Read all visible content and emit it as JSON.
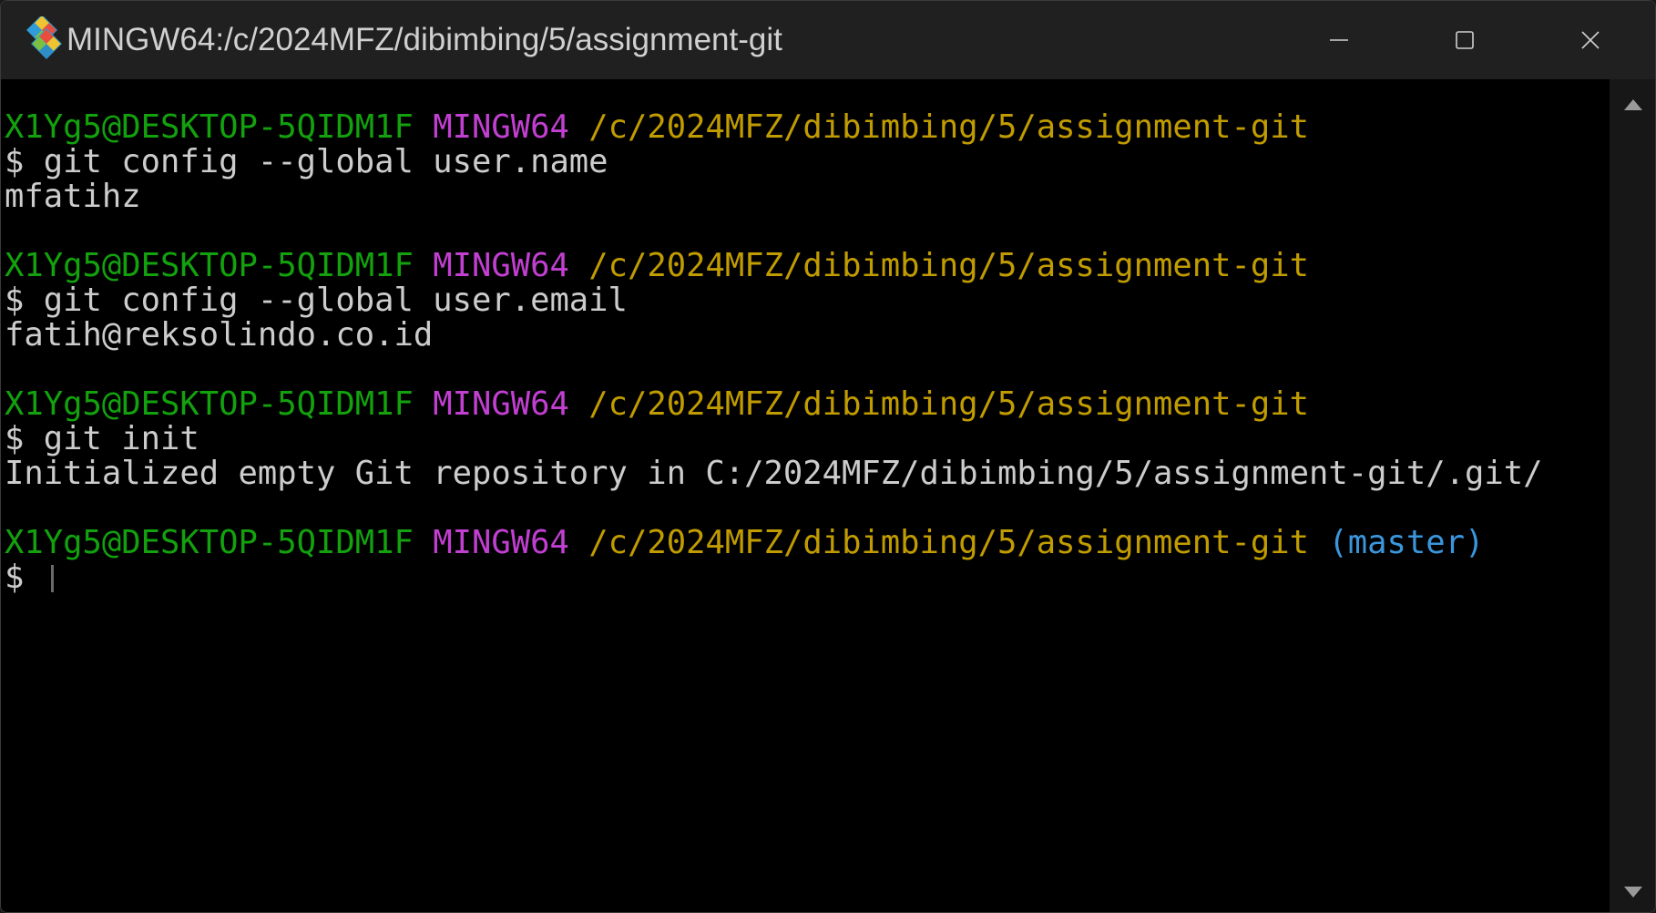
{
  "window": {
    "title": "MINGW64:/c/2024MFZ/dibimbing/5/assignment-git",
    "icon": "git-bash-icon",
    "controls": {
      "minimize": "minimize-icon",
      "maximize": "maximize-icon",
      "close": "close-icon"
    }
  },
  "colors": {
    "user_host": "#13a10e",
    "system": "#c13fd1",
    "path": "#c19c00",
    "branch": "#3a96dd",
    "text": "#cccccc",
    "background": "#000000"
  },
  "terminal": {
    "blocks": [
      {
        "prompt": {
          "user": "X1Yg5@DESKTOP-5QIDM1F",
          "system": "MINGW64",
          "path": "/c/2024MFZ/dibimbing/5/assignment-git",
          "branch": ""
        },
        "command": "$ git config --global user.name",
        "output": "mfatihz"
      },
      {
        "prompt": {
          "user": "X1Yg5@DESKTOP-5QIDM1F",
          "system": "MINGW64",
          "path": "/c/2024MFZ/dibimbing/5/assignment-git",
          "branch": ""
        },
        "command": "$ git config --global user.email",
        "output": "fatih@reksolindo.co.id"
      },
      {
        "prompt": {
          "user": "X1Yg5@DESKTOP-5QIDM1F",
          "system": "MINGW64",
          "path": "/c/2024MFZ/dibimbing/5/assignment-git",
          "branch": ""
        },
        "command": "$ git init",
        "output": "Initialized empty Git repository in C:/2024MFZ/dibimbing/5/assignment-git/.git/"
      },
      {
        "prompt": {
          "user": "X1Yg5@DESKTOP-5QIDM1F",
          "system": "MINGW64",
          "path": "/c/2024MFZ/dibimbing/5/assignment-git",
          "branch": "(master)"
        },
        "command": "$ ",
        "output": ""
      }
    ]
  },
  "scrollbar": {
    "up_icon": "scroll-up-arrow-icon",
    "down_icon": "scroll-down-arrow-icon"
  }
}
